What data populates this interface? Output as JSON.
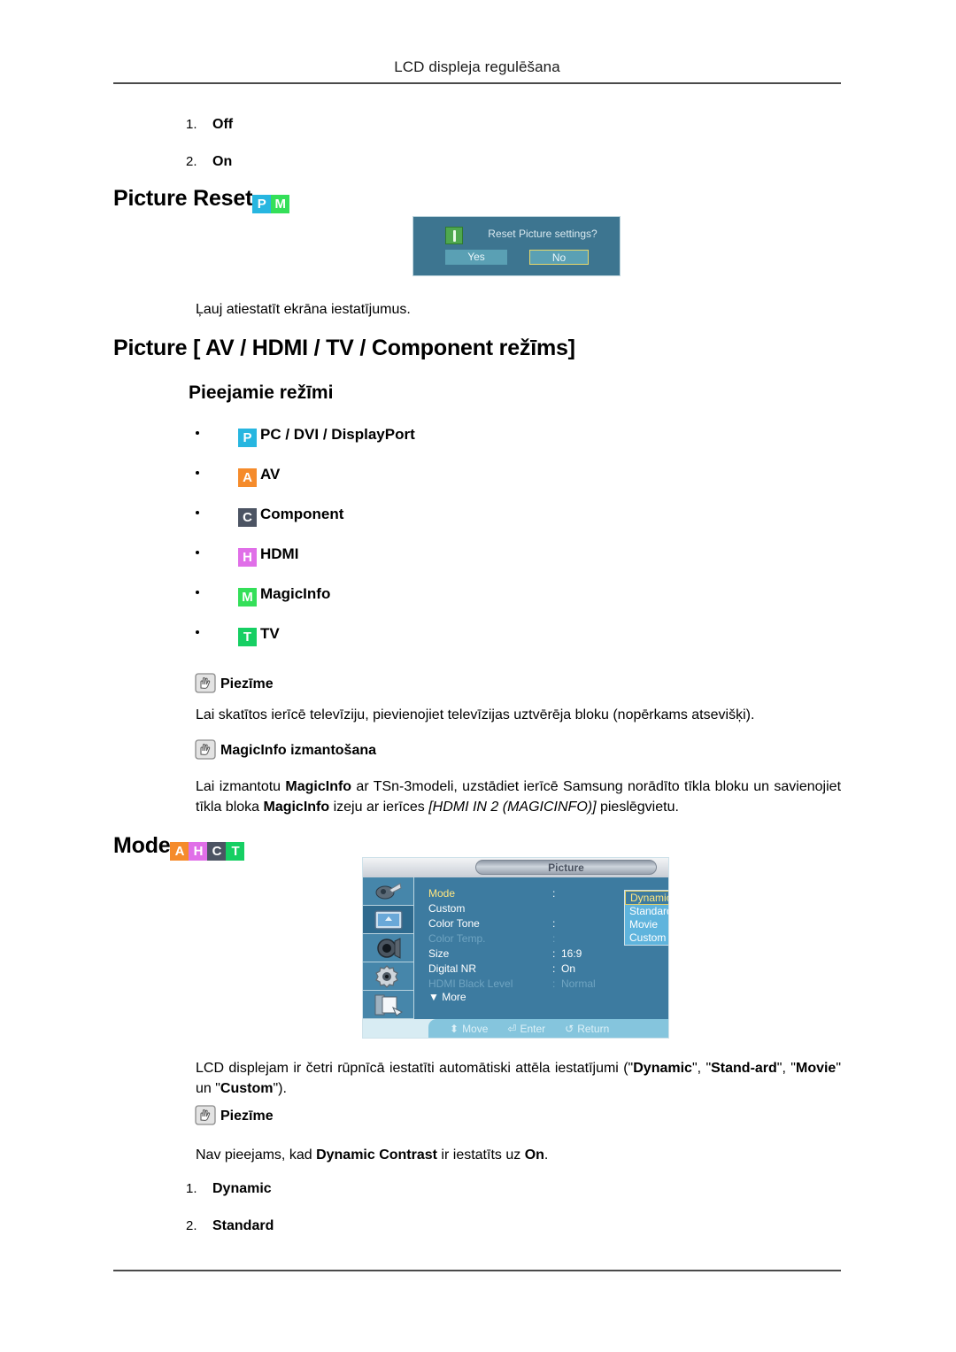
{
  "header": {
    "title": "LCD displeja regulēšana"
  },
  "top_list": [
    {
      "num": "1.",
      "label": "Off"
    },
    {
      "num": "2.",
      "label": "On"
    }
  ],
  "picture_reset": {
    "heading": "Picture Reset",
    "badges": [
      "P",
      "M"
    ],
    "caption": "Ļauj atiestatīt ekrāna iestatījumus.",
    "dialog": {
      "message": "Reset Picture settings?",
      "yes_label": "Yes",
      "no_label": "No",
      "icon": "info-icon",
      "bg_color": "#3d7590",
      "button_color": "#5aa0b4",
      "selected_border": "#e8d96a"
    }
  },
  "picture_modes": {
    "heading": "Picture [ AV / HDMI / TV / Component režīms]",
    "subheading": "Pieejamie režīmi",
    "items": [
      {
        "badges": [
          "P"
        ],
        "label": "PC / DVI / DisplayPort"
      },
      {
        "badges": [
          "A"
        ],
        "label": "AV"
      },
      {
        "badges": [
          "C"
        ],
        "label": "Component"
      },
      {
        "badges": [
          "H"
        ],
        "label": "HDMI"
      },
      {
        "badges": [
          "M"
        ],
        "label": "MagicInfo"
      },
      {
        "badges": [
          "T"
        ],
        "label": "TV"
      }
    ],
    "note1_title": "Piezīme",
    "note1_body": "Lai skatītos ierīcē televīziju, pievienojiet televīzijas uztvērēja bloku (nopērkams atsevišķi).",
    "note2_title": "MagicInfo izmantošana",
    "note2_body_part1": "Lai izmantotu ",
    "note2_body_bold1": "MagicInfo",
    "note2_body_part2": " ar TSn-3modeli, uzstādiet ierīcē Samsung norādīto tīkla bloku un savienojiet tīkla bloka ",
    "note2_body_bold2": "MagicInfo",
    "note2_body_part3": " izeju ar ierīces ",
    "note2_body_italic": "[HDMI IN 2 (MAGICINFO)]",
    "note2_body_part4": " pieslēgvietu."
  },
  "mode_section": {
    "heading": "Mode",
    "badges": [
      "A",
      "H",
      "C",
      "T"
    ],
    "osd": {
      "title": "Picture",
      "sidebar_icons": [
        "input-source-icon",
        "picture-icon",
        "sound-icon",
        "setup-gear-icon",
        "multi-control-icon"
      ],
      "selected_sidebar_index": 1,
      "rows": [
        {
          "label": "Mode",
          "colon": ":",
          "value": "",
          "state": "active"
        },
        {
          "label": "Custom",
          "colon": "",
          "value": "",
          "state": "normal"
        },
        {
          "label": "Color Tone",
          "colon": ":",
          "value": "",
          "state": "normal"
        },
        {
          "label": "Color Temp.",
          "colon": ":",
          "value": "",
          "state": "dim"
        },
        {
          "label": "Size",
          "colon": ":",
          "value": "16:9",
          "state": "normal"
        },
        {
          "label": "Digital NR",
          "colon": ":",
          "value": "On",
          "state": "normal"
        },
        {
          "label": "HDMI Black Level",
          "colon": ":",
          "value": "Normal",
          "state": "dim"
        }
      ],
      "more_label": "▼ More",
      "dropdown": {
        "options": [
          "Dynamic",
          "Standard",
          "Movie",
          "Custom"
        ],
        "selected": "Dynamic"
      },
      "footer": [
        {
          "glyph": "⬍",
          "label": "Move"
        },
        {
          "glyph": "⏎",
          "label": "Enter"
        },
        {
          "glyph": "↺",
          "label": "Return"
        }
      ]
    },
    "description_p1": "LCD displejam ir četri rūpnīcā iestatīti automātiski attēla iestatījumi (\"",
    "description_b1": "Dynamic",
    "description_p2": "\", \"",
    "description_b2": "Stand-ard",
    "description_p3": "\", \"",
    "description_b3": "Movie",
    "description_p4": "\" un \"",
    "description_b4": "Custom",
    "description_p5": "\").",
    "note_title": "Piezīme",
    "note_body_p1": "Nav pieejams, kad ",
    "note_body_b1": "Dynamic Contrast",
    "note_body_p2": " ir iestatīts uz ",
    "note_body_b2": "On",
    "note_body_p3": ".",
    "list": [
      {
        "num": "1.",
        "label": "Dynamic"
      },
      {
        "num": "2.",
        "label": "Standard"
      }
    ]
  }
}
